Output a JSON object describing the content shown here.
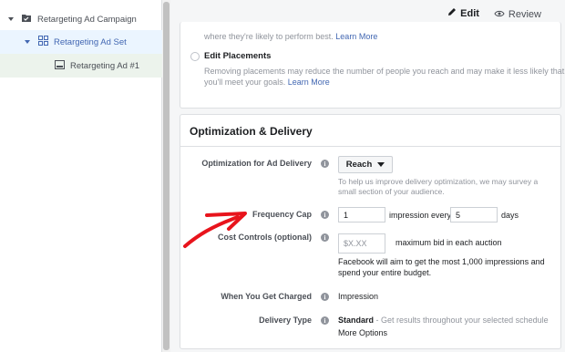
{
  "sidebar": {
    "campaign": "Retargeting Ad Campaign",
    "adset": "Retargeting Ad Set",
    "ad": "Retargeting Ad #1"
  },
  "tabs": {
    "edit": "Edit",
    "review": "Review"
  },
  "placements": {
    "top_text": "where they're likely to perform best.",
    "top_link": "Learn More",
    "edit_label": "Edit Placements",
    "edit_desc_1": "Removing placements may reduce the number of people you reach and may make it less likely that",
    "edit_desc_2": "you'll meet your goals.",
    "edit_link": "Learn More"
  },
  "optimization": {
    "title": "Optimization & Delivery",
    "opt_label": "Optimization for Ad Delivery",
    "opt_value": "Reach",
    "opt_help_1": "To help us improve delivery optimization, we may survey a",
    "opt_help_2": "small section of your audience.",
    "freq_label": "Frequency Cap",
    "freq_impressions": "1",
    "freq_mid": "impression every",
    "freq_days": "5",
    "freq_unit": "days",
    "cost_label": "Cost Controls (optional)",
    "cost_placeholder": "$X.XX",
    "cost_suffix": "maximum bid in each auction",
    "cost_help_1": "Facebook will aim to get the most 1,000 impressions and",
    "cost_help_2": "spend your entire budget.",
    "charged_label": "When You Get Charged",
    "charged_value": "Impression",
    "delivery_label": "Delivery Type",
    "delivery_value": "Standard",
    "delivery_desc": " - Get results throughout your selected schedule",
    "more_options": "More Options"
  },
  "colors": {
    "accent": "#4267b2",
    "annotation_arrow": "#e8141c"
  }
}
